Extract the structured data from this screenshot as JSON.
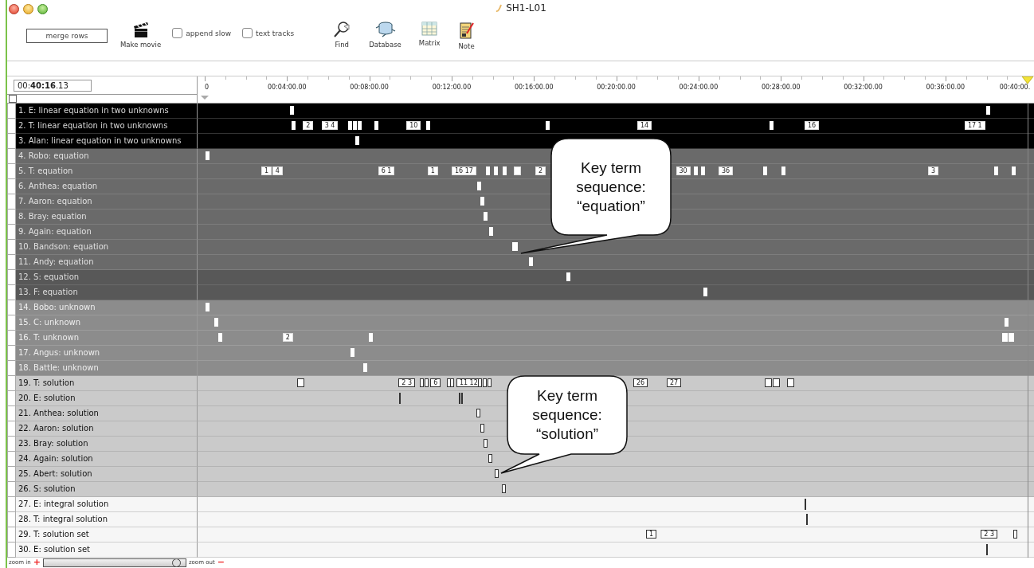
{
  "window": {
    "title": "SH1-L01"
  },
  "toolbar": {
    "merge_button": "merge rows",
    "make_movie": "Make movie",
    "checkboxes": [
      {
        "label": "append slow",
        "checked": false
      },
      {
        "label": "text tracks",
        "checked": false
      }
    ],
    "tools": [
      {
        "kind": "find",
        "label": "Find"
      },
      {
        "kind": "database",
        "label": "Database"
      },
      {
        "kind": "matrix",
        "label": "Matrix"
      },
      {
        "kind": "note",
        "label": "Note"
      }
    ]
  },
  "timecode": "00:**40:16**.13",
  "select_all": {
    "checked": false
  },
  "ruler": [
    "0",
    "00:04:00.00",
    "00:08:00.00",
    "00:12:00.00",
    "00:16:00.00",
    "00:20:00.00",
    "00:24:00.00",
    "00:28:00.00",
    "00:32:00.00",
    "00:36:00.00",
    "00:40:00."
  ],
  "groups": [
    {
      "kind": "black",
      "rows": [
        {
          "label": "1. E: linear equation in two unknowns"
        },
        {
          "label": "2. T: linear equation in two unknowns",
          "blocks": [
            "2",
            "3 4",
            "10",
            "14",
            "16",
            "17 1"
          ]
        },
        {
          "label": "3. Alan: linear equation in two unknowns"
        }
      ]
    },
    {
      "kind": "dark",
      "rows": [
        {
          "label": "4. Robo: equation"
        },
        {
          "label": "5. T: equation",
          "blocks": [
            "1",
            "4",
            "6 1",
            "1",
            "16 17",
            "2",
            "30",
            "36",
            "3"
          ]
        },
        {
          "label": "6. Anthea: equation"
        },
        {
          "label": "7. Aaron: equation"
        },
        {
          "label": "8. Bray: equation"
        },
        {
          "label": "9. Again: equation"
        },
        {
          "label": "10. Bandson: equation"
        },
        {
          "label": "11. Andy: equation"
        }
      ]
    },
    {
      "kind": "darker",
      "rows": [
        {
          "label": "12. S: equation"
        },
        {
          "label": "13. F: equation"
        }
      ]
    },
    {
      "kind": "mid",
      "rows": [
        {
          "label": "14. Bobo: unknown"
        },
        {
          "label": "15. C: unknown"
        },
        {
          "label": "16. T: unknown",
          "blocks": [
            "2"
          ]
        },
        {
          "label": "17. Angus: unknown"
        },
        {
          "label": "18. Battle: unknown"
        }
      ]
    },
    {
      "kind": "light",
      "rows": [
        {
          "label": "19. T: solution",
          "blocks": [
            "2 3",
            "6",
            "11 12",
            "26",
            "27"
          ]
        },
        {
          "label": "20. E: solution"
        },
        {
          "label": "21. Anthea: solution"
        },
        {
          "label": "22. Aaron: solution"
        },
        {
          "label": "23. Bray: solution"
        },
        {
          "label": "24. Again: solution"
        },
        {
          "label": "25. Abert: solution"
        },
        {
          "label": "26. S: solution"
        }
      ]
    },
    {
      "kind": "white",
      "rows": [
        {
          "label": "27. E: integral solution"
        },
        {
          "label": "28. T: integral solution"
        },
        {
          "label": "29. T: solution set",
          "blocks": [
            "1",
            "2 3"
          ]
        },
        {
          "label": "30. E: solution set"
        }
      ]
    }
  ],
  "callouts": [
    {
      "text": "Key term sequence: “equation”"
    },
    {
      "text": "Key term sequence: “solution”"
    }
  ],
  "zoom": {
    "zoom_in": "zoom in",
    "plus": "+",
    "zoom_out": "zoom out",
    "minus": "−",
    "level": 0.95
  }
}
